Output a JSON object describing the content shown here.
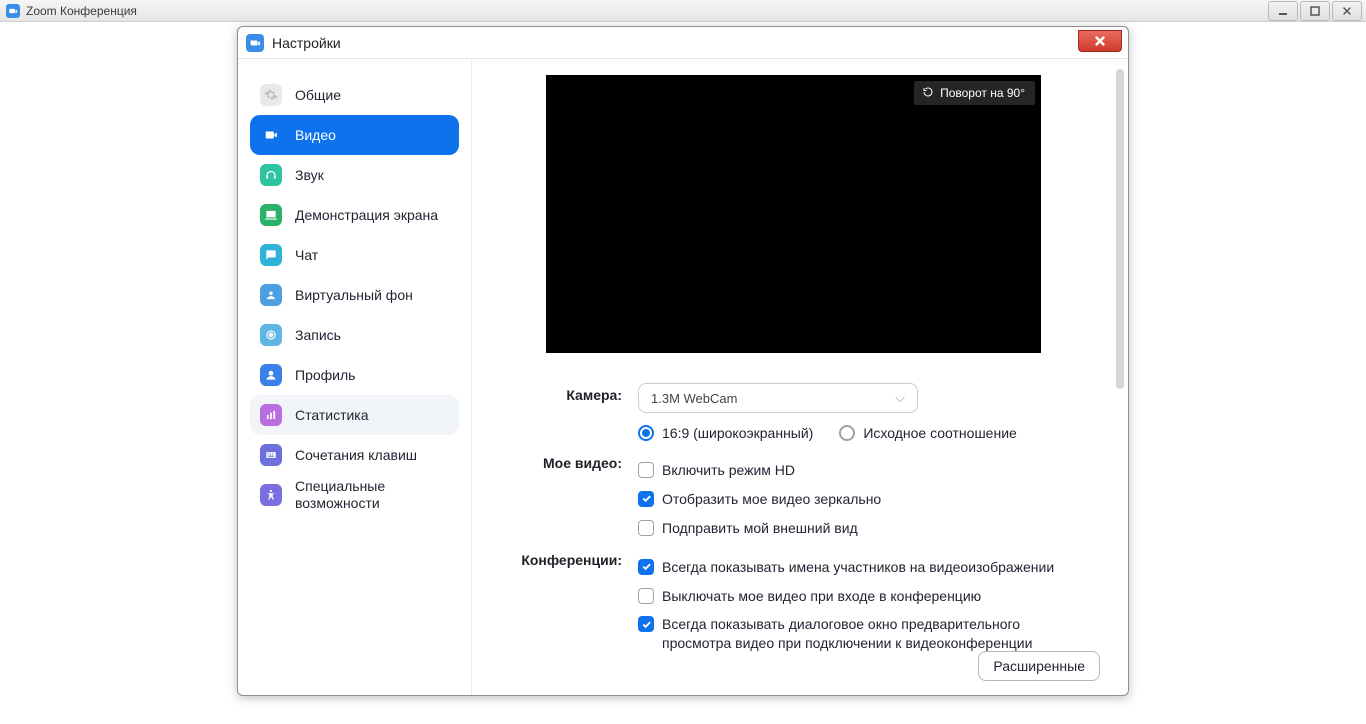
{
  "window": {
    "title": "Zoom Конференция"
  },
  "dialog": {
    "title": "Настройки",
    "close": "✕"
  },
  "win_controls": {
    "min": "—",
    "max": "▢",
    "close": "✕"
  },
  "sidebar": {
    "items": [
      {
        "label": "Общие"
      },
      {
        "label": "Видео"
      },
      {
        "label": "Звук"
      },
      {
        "label": "Демонстрация экрана"
      },
      {
        "label": "Чат"
      },
      {
        "label": "Виртуальный фон"
      },
      {
        "label": "Запись"
      },
      {
        "label": "Профиль"
      },
      {
        "label": "Статистика"
      },
      {
        "label": "Сочетания клавиш"
      },
      {
        "label": "Специальные возможности"
      }
    ]
  },
  "preview": {
    "rotate": "Поворот на 90°"
  },
  "form": {
    "camera_label": "Камера:",
    "camera_value": "1.3M WebCam",
    "aspect_16_9": "16:9 (широкоэкранный)",
    "aspect_orig": "Исходное соотношение",
    "myvideo_label": "Мое видео:",
    "hd": "Включить режим HD",
    "mirror": "Отобразить мое видео зеркально",
    "touchup": "Подправить мой внешний вид",
    "conf_label": "Конференции:",
    "show_names": "Всегда показывать имена участников на видеоизображении",
    "mute_video": "Выключать мое видео при входе в конференцию",
    "preview_dialog": "Всегда показывать диалоговое окно предварительного просмотра видео при подключении к видеоконференции",
    "advanced": "Расширенные"
  }
}
